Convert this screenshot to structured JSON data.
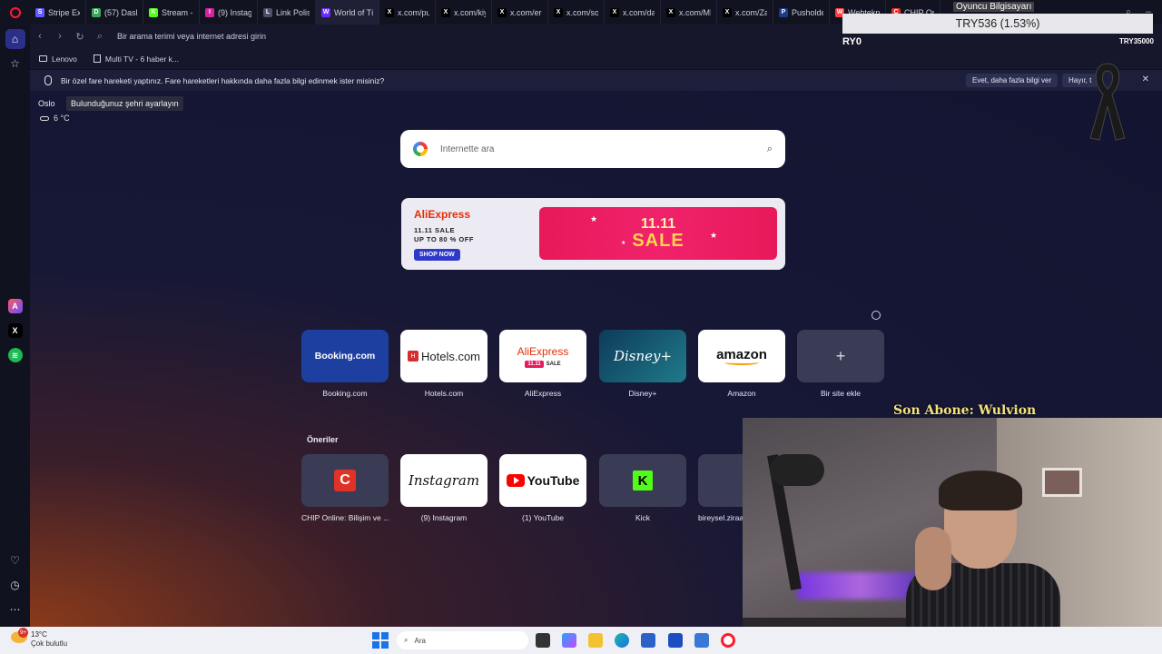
{
  "tabs": [
    {
      "label": "Stripe Expre",
      "color": "#635bff",
      "glyph": "S"
    },
    {
      "label": "(57) Dashbo",
      "color": "#3ba55d",
      "glyph": "D"
    },
    {
      "label": "Stream - Ki",
      "color": "#53fc18",
      "glyph": "K"
    },
    {
      "label": "(9) Instagram",
      "color": "#d6249f",
      "glyph": "I"
    },
    {
      "label": "Link Polisi H",
      "color": "#4a4f6a",
      "glyph": "L"
    },
    {
      "label": "World of Tü",
      "color": "#6b2cff",
      "glyph": "W"
    },
    {
      "label": "x.com/push",
      "color": "#000000",
      "glyph": "X"
    },
    {
      "label": "x.com/kiyas",
      "color": "#000000",
      "glyph": "X"
    },
    {
      "label": "x.com/erenl",
      "color": "#000000",
      "glyph": "X"
    },
    {
      "label": "x.com/solcu",
      "color": "#000000",
      "glyph": "X"
    },
    {
      "label": "x.com/darla",
      "color": "#000000",
      "glyph": "X"
    },
    {
      "label": "x.com/MDR",
      "color": "#000000",
      "glyph": "X"
    },
    {
      "label": "x.com/Zam",
      "color": "#000000",
      "glyph": "X"
    },
    {
      "label": "Pusholder c",
      "color": "#1e3a8a",
      "glyph": "P"
    },
    {
      "label": "Webtekno",
      "color": "#ff3d3d",
      "glyph": "W"
    },
    {
      "label": "CHIP Online",
      "color": "#e03226",
      "glyph": "C"
    }
  ],
  "address": {
    "placeholder": "Bir arama terimi veya internet adresi girin"
  },
  "bookmarks": {
    "item1": "Lenovo",
    "item2": "Multi TV - 6 haber k..."
  },
  "infobar": {
    "message": "Bir özel fare hareketi yaptınız. Fare hareketleri hakkında daha fazla bilgi edinmek ister misiniz?",
    "yes_label": "Evet, daha fazla bilgi ver",
    "no_label": "Hayır, t"
  },
  "weather": {
    "city": "Oslo",
    "tooltip": "Bulunduğunuz şehri ayarlayın",
    "temp": "6 °C"
  },
  "search": {
    "placeholder": "İnternette ara"
  },
  "ad": {
    "brand": "AliExpress",
    "line1": "11.11 SALE",
    "line2": "UP TO 80 % OFF",
    "cta": "SHOP NOW",
    "banner_top": "11.11",
    "banner_main": "SALE"
  },
  "speed_dial": [
    {
      "label": "Booking.com",
      "logo": "Booking.com"
    },
    {
      "label": "Hotels.com",
      "logo": "Hotels.com"
    },
    {
      "label": "AliExpress",
      "logo": "AliExpress",
      "sub_badge": "11.11",
      "sub": "SALE"
    },
    {
      "label": "Disney+",
      "logo": "Disney+"
    },
    {
      "label": "Amazon",
      "logo": "amazon"
    },
    {
      "label": "Bir site ekle",
      "logo": "+"
    }
  ],
  "suggestions": {
    "heading": "Öneriler",
    "items": [
      {
        "label": "CHIP Online: Bilişim ve ...",
        "logo": "C"
      },
      {
        "label": "(9) Instagram",
        "logo": "Instagram"
      },
      {
        "label": "(1) YouTube",
        "logo": "YouTube"
      },
      {
        "label": "Kick",
        "logo": "K"
      },
      {
        "label": "bireysel.ziraa",
        "logo": "B"
      }
    ]
  },
  "overlay": {
    "ticker": "TRY536 (1.53%)",
    "ticker_top": "Oyuncu Bilgisayarı",
    "ticker_left": "RY0",
    "ticker_right": "TRY35000",
    "son_abone": "Son Abone: Wulvion"
  },
  "taskbar": {
    "temp": "13°C",
    "desc": "Çok bulutlu",
    "badge": "9+",
    "search_placeholder": "Ara"
  }
}
